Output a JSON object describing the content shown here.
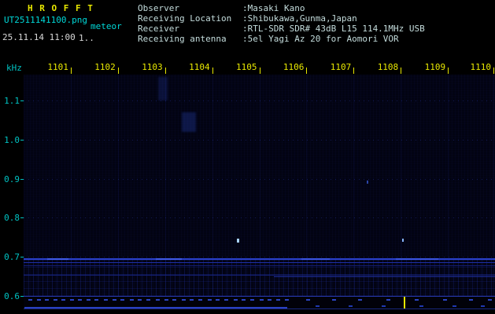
{
  "header": {
    "app_title": "H R O F F T",
    "filename": "UT2511141100.png",
    "mode": "meteor",
    "datetime": "25.11.14 11:00",
    "counter": "1..",
    "info": [
      {
        "label": "Observer",
        "value": ":Masaki Kano"
      },
      {
        "label": "Receiving Location",
        "value": ":Shibukawa,Gunma,Japan"
      },
      {
        "label": "Receiver",
        "value": ":RTL-SDR SDR# 43dB L15 114.1MHz USB"
      },
      {
        "label": "Receiving antenna",
        "value": ":5el Yagi Az 20 for Aomori VOR"
      }
    ]
  },
  "chart_data": {
    "type": "heatmap",
    "x_axis": {
      "range": [
        1100,
        1110
      ],
      "ticks": [
        "1101",
        "1102",
        "1103",
        "1104",
        "1105",
        "1106",
        "1107",
        "1108",
        "1109",
        "1110"
      ]
    },
    "y_axis": {
      "unit": "kHz",
      "range": [
        0.6,
        1.165
      ],
      "ticks": [
        "1.1",
        "1.0",
        "0.9",
        "0.8",
        "0.7",
        "0.6"
      ]
    },
    "grid": true,
    "features": [
      {
        "name": "carrier-band-main",
        "t_start": 1100,
        "t_end": 1110,
        "f_low": 0.692,
        "f_high": 0.696,
        "color": "#2a40cc"
      },
      {
        "name": "carrier-band-bright-1",
        "t_start": 1100.5,
        "t_end": 1100.95,
        "f_low": 0.693,
        "f_high": 0.6965,
        "color": "#3f5ae8"
      },
      {
        "name": "carrier-band-bright-2",
        "t_start": 1102.8,
        "t_end": 1103.35,
        "f_low": 0.693,
        "f_high": 0.6965,
        "color": "#3f5ae8"
      },
      {
        "name": "carrier-band-bright-3",
        "t_start": 1105.9,
        "t_end": 1106.5,
        "f_low": 0.693,
        "f_high": 0.6965,
        "color": "#3a54e2"
      },
      {
        "name": "carrier-band-bright-4",
        "t_start": 1107.9,
        "t_end": 1108.8,
        "f_low": 0.693,
        "f_high": 0.6965,
        "color": "#3a54e2"
      },
      {
        "name": "carrier-band-second",
        "t_start": 1100,
        "t_end": 1110,
        "f_low": 0.684,
        "f_high": 0.687,
        "color": "#1d2ea6"
      },
      {
        "name": "carrier-band-third",
        "t_start": 1100,
        "t_end": 1110,
        "f_low": 0.6775,
        "f_high": 0.679,
        "color": "#141f7d",
        "opacity": 0.9
      },
      {
        "name": "lower-band",
        "t_start": 1100,
        "t_end": 1110,
        "f_low": 0.6535,
        "f_high": 0.655,
        "color": "#16227f"
      },
      {
        "name": "lower-band-right",
        "t_start": 1105.3,
        "t_end": 1110,
        "f_low": 0.649,
        "f_high": 0.651,
        "color": "#1b2a96"
      },
      {
        "name": "meteor-echo-1",
        "t_start": 1104.53,
        "t_end": 1104.58,
        "f_low": 0.737,
        "f_high": 0.747,
        "color": "#a8d2ff"
      },
      {
        "name": "meteor-echo-2",
        "t_start": 1108.03,
        "t_end": 1108.07,
        "f_low": 0.738,
        "f_high": 0.746,
        "color": "#86b4ff"
      },
      {
        "name": "faint-echo",
        "t_start": 1107.27,
        "t_end": 1107.31,
        "f_low": 0.888,
        "f_high": 0.896,
        "color": "#3350c0",
        "opacity": 0.85
      },
      {
        "name": "noise-smudge-1",
        "t_start": 1103.35,
        "t_end": 1103.65,
        "f_low": 1.02,
        "f_high": 1.07,
        "color": "rgba(40,70,190,0.30)",
        "blur": 1
      },
      {
        "name": "noise-smudge-2",
        "t_start": 1102.85,
        "t_end": 1103.05,
        "f_low": 1.1,
        "f_high": 1.16,
        "color": "rgba(35,60,170,0.25)",
        "blur": 1
      }
    ],
    "signal_strip": {
      "marks_upper": [
        1100.1,
        1100.28,
        1100.45,
        1100.63,
        1100.8,
        1100.98,
        1101.15,
        1101.33,
        1101.5,
        1101.7,
        1101.88,
        1102.05,
        1102.25,
        1102.42,
        1102.6,
        1102.8,
        1102.98,
        1103.15,
        1103.35,
        1103.52,
        1103.7,
        1103.9,
        1104.08,
        1104.25,
        1104.45,
        1104.63,
        1104.8,
        1105.0,
        1105.18,
        1105.35,
        1105.55,
        1106.0,
        1106.55,
        1107.1,
        1107.7,
        1108.3,
        1108.9,
        1109.45,
        1109.85
      ],
      "marks_lower": [
        1106.2,
        1106.9,
        1107.6,
        1108.4,
        1109.1,
        1109.7
      ],
      "baseline": {
        "t_start": 1100.02,
        "t_end": 1105.6
      },
      "event_tick_t": 1108.06,
      "event_tick_color": "#e8e800"
    }
  },
  "colors": {
    "accent_yellow": "#e8e800",
    "axis_cyan": "#00c2c2",
    "header_text": "#c4dcdc",
    "white_text": "#d8d8d8",
    "filename_cyan": "#00d8d8",
    "grid_blue": "#2d41c8",
    "band_blue": "#2a40cc",
    "background": "#000000",
    "plot_background": "#020312"
  }
}
